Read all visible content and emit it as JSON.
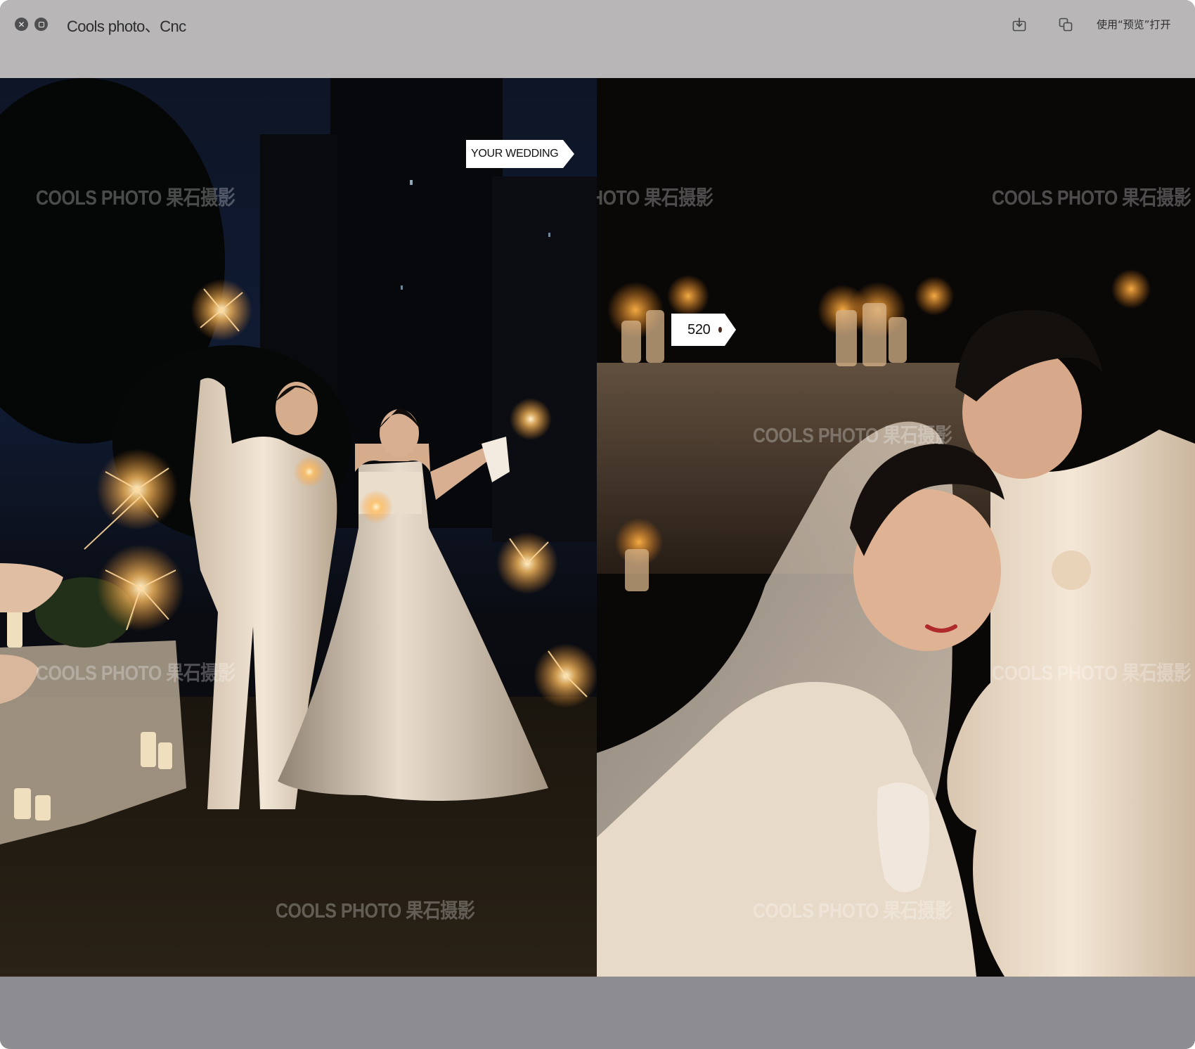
{
  "window": {
    "title": "Cools photo、Cnc",
    "open_with_label": "使用“预览”打开",
    "close_icon": "close-icon",
    "fullscreen_icon": "fullscreen-icon",
    "share_icon": "share-download-icon",
    "copy_icon": "copy-icon"
  },
  "photos": {
    "left": {
      "tag": "YOUR WEDDING",
      "watermarks": [
        "COOLS PHOTO 果石摄影",
        "COOLS PHOTO 果石摄影",
        "COOLS PHOTO 果石摄影"
      ]
    },
    "right": {
      "tag": "520",
      "watermarks": [
        "COOLS PHOTO 果石摄影",
        "COOLS PHOTO 果石摄影",
        "COOLS PHOTO 果石摄影",
        "COOLS PHOTO 果石摄影",
        "COOLS PHOTO 果石摄影"
      ]
    }
  },
  "colors": {
    "titlebar": "#b8b6b7",
    "bottombar": "#8c8c91",
    "photo_background": "#0b0a09",
    "suit": "#efe2d2",
    "sparkler": "#ffd08a"
  }
}
